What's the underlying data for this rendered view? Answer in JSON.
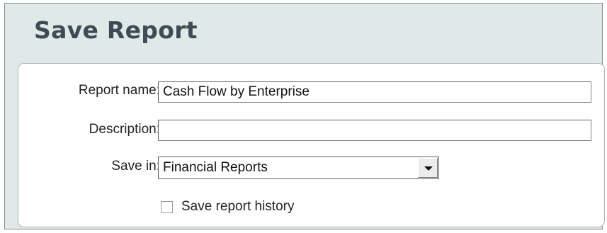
{
  "dialog": {
    "title": "Save Report"
  },
  "form": {
    "report_name": {
      "label": "Report name:",
      "value": "Cash Flow by Enterprise"
    },
    "description": {
      "label": "Description:",
      "value": ""
    },
    "save_in": {
      "label": "Save in:",
      "value": "Financial Reports"
    },
    "save_history": {
      "label": "Save report history",
      "checked": false
    }
  },
  "icons": {
    "dropdown": "chevron-down-icon"
  }
}
